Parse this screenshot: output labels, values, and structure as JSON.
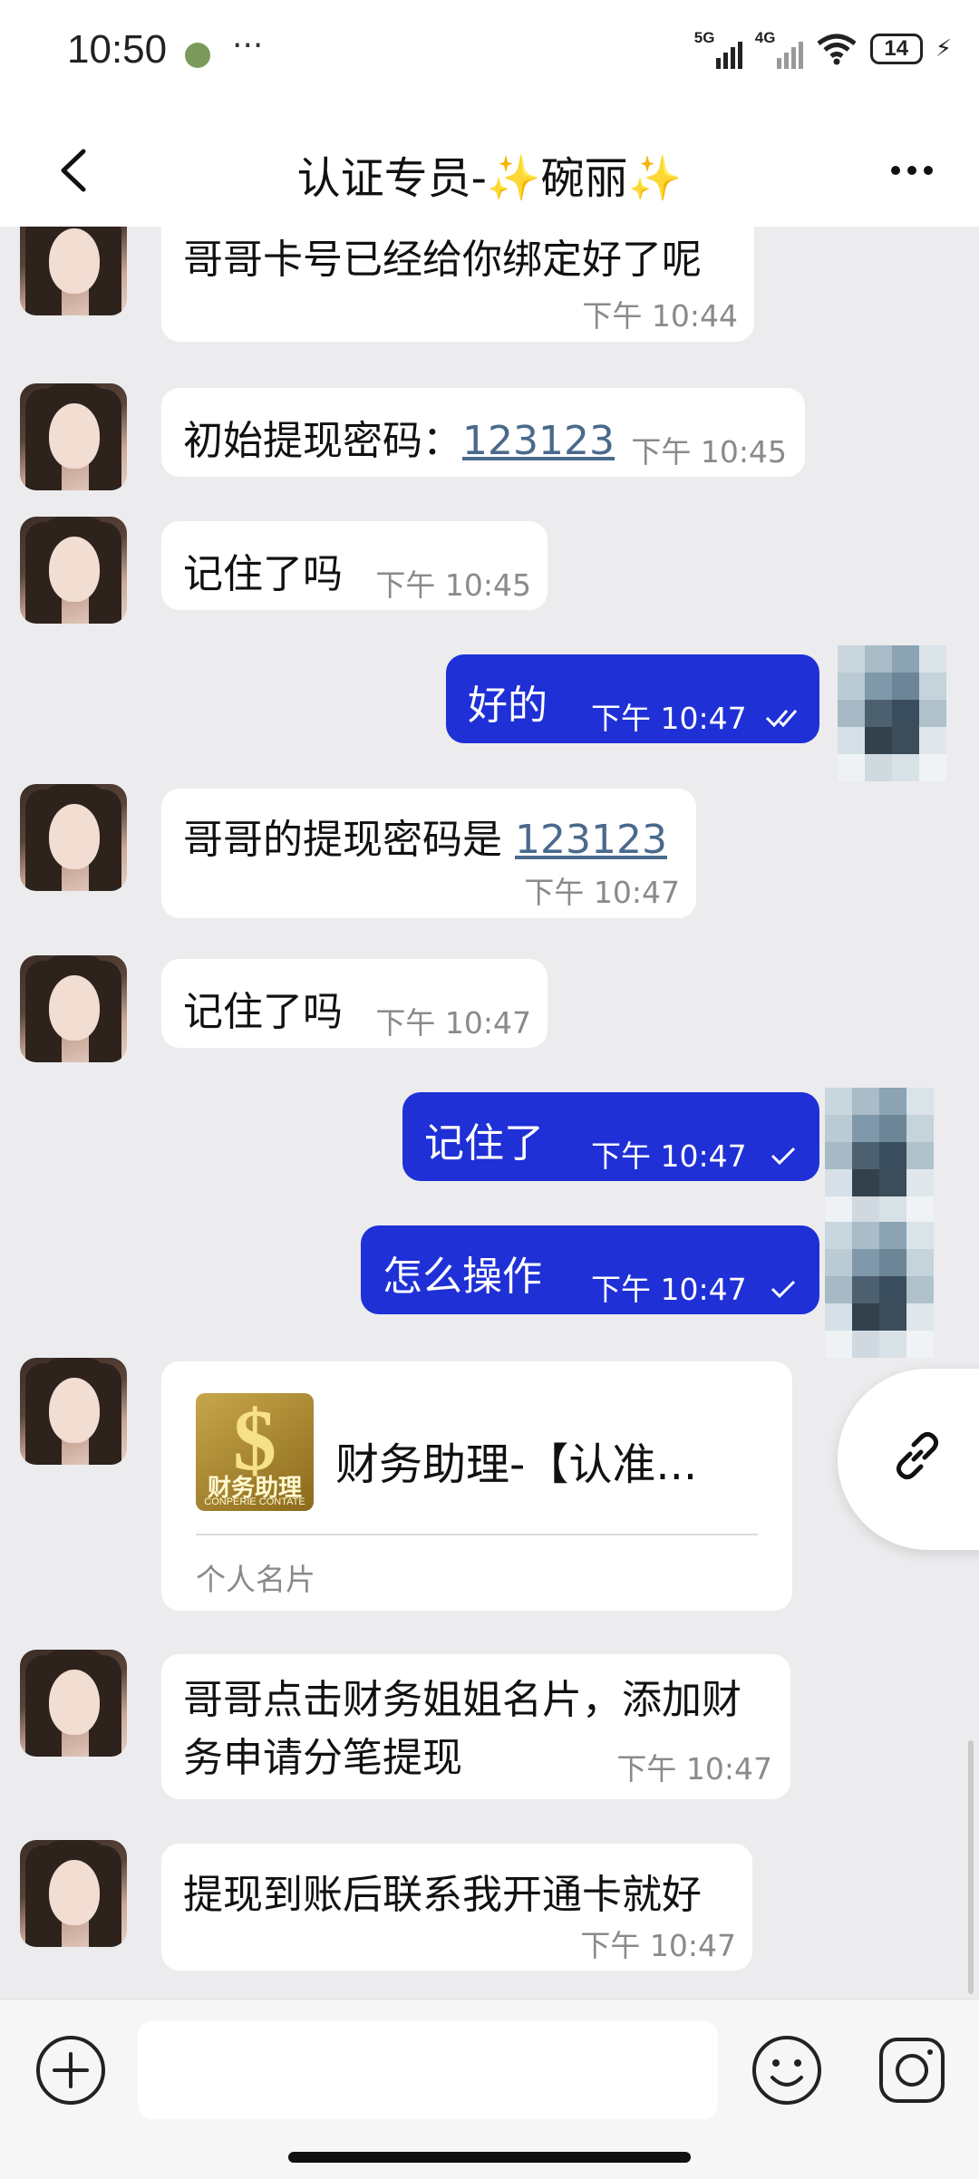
{
  "status_bar": {
    "time": "10:50",
    "net1": "5G",
    "net2": "4G",
    "battery": "14",
    "dots": "···"
  },
  "header": {
    "title": "认证专员-✨碗丽✨"
  },
  "messages": [
    {
      "text": "哥哥卡号已经给你绑定好了呢",
      "time": "下午 10:44"
    },
    {
      "text": "初始提现密码：",
      "link": "123123",
      "time": "下午 10:45"
    },
    {
      "text": "记住了吗",
      "time": "下午 10:45"
    },
    {
      "text": "好的",
      "time": "下午 10:47"
    },
    {
      "text": "哥哥的提现密码是 ",
      "link": "123123",
      "time": "下午 10:47"
    },
    {
      "text": "记住了吗",
      "time": "下午 10:47"
    },
    {
      "text": "记住了",
      "time": "下午 10:47"
    },
    {
      "text": "怎么操作",
      "time": "下午 10:47"
    },
    {
      "card_title": "财务助理-【认准...",
      "card_type": "个人名片",
      "logo_cn": "财务助理",
      "logo_en": "CONPERIE CONTATE",
      "logo_symbol": "$"
    },
    {
      "line1": "哥哥点击财务姐姐名片，添加财",
      "line2": "务申请分笔提现",
      "time": "下午 10:47"
    },
    {
      "text": "提现到账后联系我开通卡就好",
      "time": "下午 10:47"
    }
  ],
  "input": {
    "placeholder": ""
  },
  "colors": {
    "outgoing_bubble": "#1f30d6",
    "incoming_bubble": "#ffffff",
    "chat_background": "#ececee",
    "link_text": "#4a6a8c"
  },
  "icons": {
    "back": "back-arrow-icon",
    "more": "more-dots-icon",
    "link": "link-icon",
    "plus": "plus-icon",
    "emoji": "emoji-icon",
    "camera": "camera-icon",
    "wifi": "wifi-icon",
    "battery": "battery-icon"
  }
}
